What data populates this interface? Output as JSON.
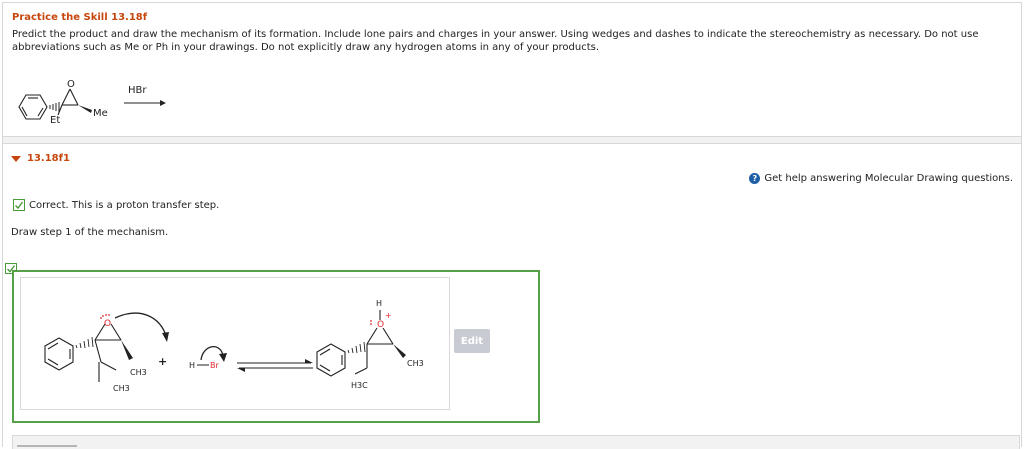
{
  "header": {
    "title": "Practice the Skill 13.18f",
    "instructions": "Predict the product and draw the mechanism of its formation. Include lone pairs and charges in your answer. Using wedges and dashes to indicate the stereochemistry as necessary. Do not use abbreviations such as Me or Ph in your drawings. Do not explicitly draw any hydrogen atoms in any of your products."
  },
  "reaction": {
    "reagent": "HBr",
    "atom_o": "O",
    "sub_et": "Et",
    "sub_me": "Me"
  },
  "part": {
    "label": "13.18f1",
    "help_text": "Get help answering Molecular Drawing questions.",
    "help_icon": "?",
    "feedback": "Correct. This is a proton transfer step.",
    "prompt": "Draw step 1 of the mechanism."
  },
  "drawing": {
    "o_reactant": "O",
    "ch3_a": "CH3",
    "ch3_b": "CH3",
    "plus": "+",
    "h": "H",
    "br": "Br",
    "o_product": "O",
    "h_top": "H",
    "plus_charge": "+",
    "ch3_product": "CH3",
    "h3c_product": "H3C"
  },
  "buttons": {
    "edit": "Edit"
  },
  "colors": {
    "accent": "#c6470e",
    "correct": "#56a148",
    "oxygen": "#e0262b",
    "help": "#1f5fa8"
  }
}
